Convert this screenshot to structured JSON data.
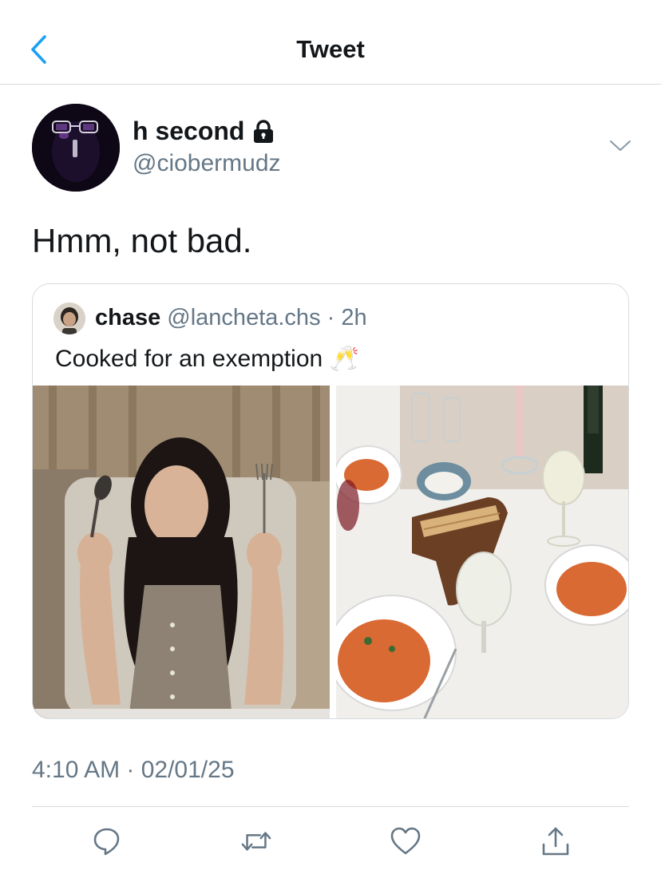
{
  "header": {
    "title": "Tweet",
    "back_icon": "chevron-left-icon",
    "accent_color": "#1da1f2"
  },
  "tweet": {
    "author": {
      "display_name": "h second",
      "handle": "@ciobermudz",
      "protected_icon": "lock-icon"
    },
    "text": "Hmm, not bad.",
    "timestamp": "4:10 AM · 02/01/25"
  },
  "quote": {
    "author": {
      "display_name": "chase",
      "handle": "@lancheta.chs",
      "separator": " · ",
      "age": "2h"
    },
    "text": "Cooked for an exemption 🥂",
    "media": [
      {
        "icon": "photo-person-with-utensils"
      },
      {
        "icon": "photo-pasta-dinner-table"
      }
    ]
  },
  "actions": [
    {
      "name": "reply",
      "icon": "reply-icon"
    },
    {
      "name": "retweet",
      "icon": "retweet-icon"
    },
    {
      "name": "like",
      "icon": "heart-icon"
    },
    {
      "name": "share",
      "icon": "share-icon"
    }
  ],
  "colors": {
    "text_primary": "#14171a",
    "text_secondary": "#657786",
    "border": "#d7dbde"
  }
}
